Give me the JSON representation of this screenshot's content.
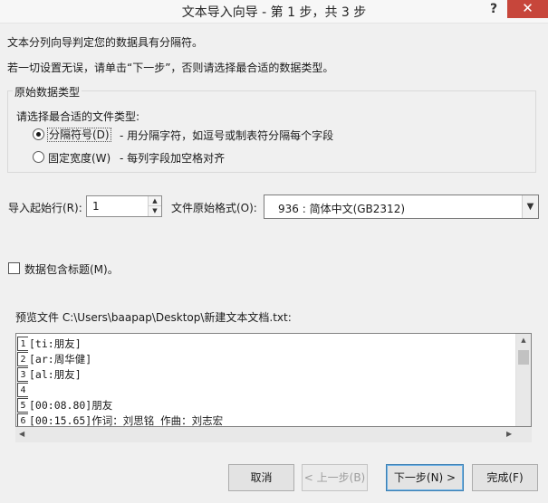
{
  "dialog": {
    "title": "文本导入向导 - 第 1 步，共 3 步",
    "help_symbol": "?",
    "close_symbol": "✕"
  },
  "intro": {
    "line1": "文本分列向导判定您的数据具有分隔符。",
    "line2": "若一切设置无误，请单击“下一步”，否则请选择最合适的数据类型。"
  },
  "data_type_group": {
    "legend": "原始数据类型",
    "prompt": "请选择最合适的文件类型:",
    "options": [
      {
        "label": "分隔符号(D)",
        "description": "- 用分隔字符，如逗号或制表符分隔每个字段",
        "selected": true
      },
      {
        "label": "固定宽度(W)",
        "description": "- 每列字段加空格对齐",
        "selected": false
      }
    ]
  },
  "start_row": {
    "label": "导入起始行(R):",
    "value": "1"
  },
  "file_origin": {
    "label": "文件原始格式(O):",
    "value": "936 : 简体中文(GB2312)"
  },
  "headers_checkbox": {
    "label": "数据包含标题(M)。",
    "checked": false
  },
  "preview": {
    "label": "预览文件 C:\\Users\\baapap\\Desktop\\新建文本文档.txt:",
    "lines": [
      {
        "num": "1",
        "text": "[ti:朋友]"
      },
      {
        "num": "2",
        "text": "[ar:周华健]"
      },
      {
        "num": "3",
        "text": "[al:朋友]"
      },
      {
        "num": "4",
        "text": ""
      },
      {
        "num": "5",
        "text": "[00:08.80]朋友"
      },
      {
        "num": "6",
        "text": "[00:15.65]作词：刘思铭 作曲：刘志宏"
      }
    ]
  },
  "buttons": {
    "cancel": "取消",
    "back": "< 上一步(B)",
    "next": "下一步(N) >",
    "finish": "完成(F)"
  }
}
